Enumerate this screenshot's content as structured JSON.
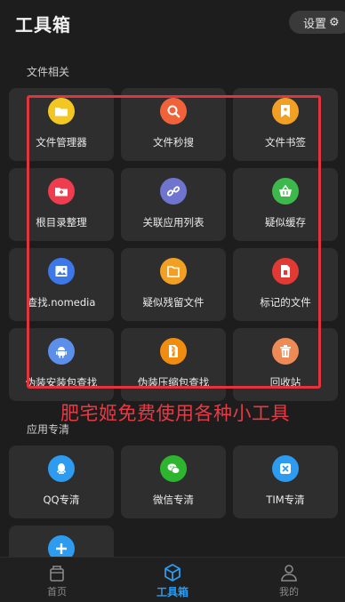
{
  "header": {
    "title": "工具箱",
    "settings_label": "设置",
    "settings_icon": "gear-icon"
  },
  "sections": {
    "file": {
      "title": "文件相关"
    },
    "app": {
      "title": "应用专清"
    }
  },
  "file_tools": [
    {
      "label": "文件管理器",
      "icon": "folder-icon",
      "color": "#f3c623"
    },
    {
      "label": "文件秒搜",
      "icon": "search-icon",
      "color": "#f0633a"
    },
    {
      "label": "文件书签",
      "icon": "bookmark-icon",
      "color": "#f2a024"
    },
    {
      "label": "根目录整理",
      "icon": "folder-icon",
      "color": "#ef3c4e"
    },
    {
      "label": "关联应用列表",
      "icon": "link-icon",
      "color": "#6f74cf"
    },
    {
      "label": "疑似缓存",
      "icon": "basket-icon",
      "color": "#3cb94a"
    },
    {
      "label": "查找.nomedia",
      "icon": "image-icon",
      "color": "#3d78e8"
    },
    {
      "label": "疑似残留文件",
      "icon": "file-icon",
      "color": "#f2a024"
    },
    {
      "label": "标记的文件",
      "icon": "marked-file-icon",
      "color": "#e13a34"
    },
    {
      "label": "伪装安装包查找",
      "icon": "android-icon",
      "color": "#5c8fe9"
    },
    {
      "label": "伪装压缩包查找",
      "icon": "zip-icon",
      "color": "#f08c10"
    },
    {
      "label": "回收站",
      "icon": "trash-icon",
      "color": "#ee8a55"
    }
  ],
  "app_tools": [
    {
      "label": "QQ专清",
      "icon": "qq-icon",
      "color": "#2d9cf0"
    },
    {
      "label": "微信专清",
      "icon": "wechat-icon",
      "color": "#2eb52f"
    },
    {
      "label": "TIM专清",
      "icon": "tim-icon",
      "color": "#2d9cf0"
    },
    {
      "label": "",
      "icon": "plus-icon",
      "color": "#2d9cf0"
    }
  ],
  "annotation": {
    "text": "肥宅姬免费使用各种小工具",
    "color": "#e83a44"
  },
  "bottom_nav": [
    {
      "label": "首页",
      "icon": "home-icon",
      "active": false
    },
    {
      "label": "工具箱",
      "icon": "cube-icon",
      "active": true
    },
    {
      "label": "我的",
      "icon": "user-icon",
      "active": false
    }
  ]
}
